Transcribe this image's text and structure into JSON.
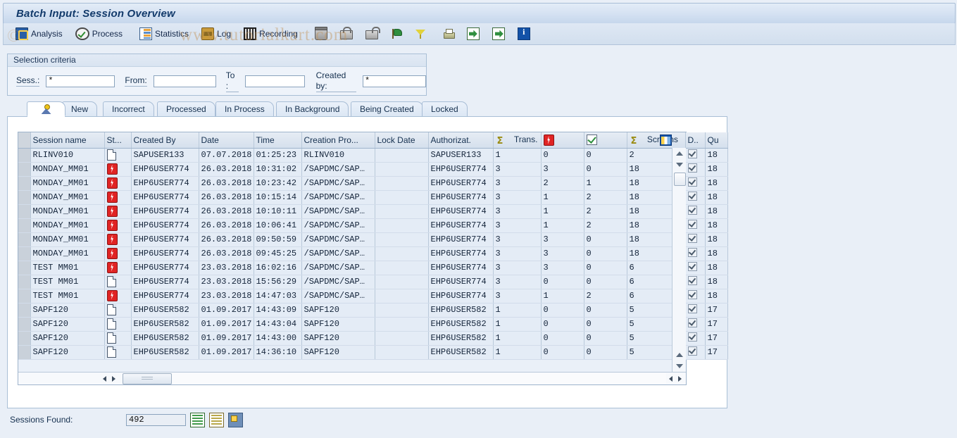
{
  "window": {
    "title": "Batch Input: Session Overview"
  },
  "watermark": {
    "text": "www.tutorialkart.com",
    "copyright": "©"
  },
  "toolbar": {
    "items": [
      {
        "label": "Analysis",
        "icon": "analysis-icon"
      },
      {
        "label": "Process",
        "icon": "process-icon"
      },
      {
        "label": "Statistics",
        "icon": "statistics-icon"
      },
      {
        "label": "Log",
        "icon": "log-icon"
      },
      {
        "label": "Recording",
        "icon": "recording-icon"
      }
    ],
    "icon_only": [
      {
        "icon": "delete-icon",
        "name": "delete-button"
      },
      {
        "icon": "lock-icon",
        "name": "lock-button"
      },
      {
        "icon": "unlock-icon",
        "name": "unlock-button"
      },
      {
        "icon": "flag-icon",
        "name": "flag-button"
      },
      {
        "icon": "filter-icon",
        "name": "filter-button"
      },
      {
        "icon": "print-icon",
        "name": "print-button"
      },
      {
        "icon": "import-icon",
        "name": "import-button"
      },
      {
        "icon": "export-icon",
        "name": "export-button"
      },
      {
        "icon": "info-icon",
        "name": "info-button"
      }
    ]
  },
  "selection": {
    "legend": "Selection criteria",
    "sess_label": "Sess.:",
    "sess_value": "*",
    "from_label": "From:",
    "from_value": "",
    "to_label": "To :",
    "to_value": "",
    "created_by_label": "Created by:",
    "created_by_value": "*"
  },
  "tabs": [
    {
      "label": "",
      "icon": "person-icon",
      "active": true
    },
    {
      "label": "New",
      "active": false
    },
    {
      "label": "Incorrect",
      "active": false
    },
    {
      "label": "Processed",
      "active": false
    },
    {
      "label": "In Process",
      "active": false
    },
    {
      "label": "In Background",
      "active": false
    },
    {
      "label": "Being Created",
      "active": false
    },
    {
      "label": "Locked",
      "active": false
    }
  ],
  "grid": {
    "columns": [
      {
        "key": "sel",
        "label": "",
        "icon": ""
      },
      {
        "key": "name",
        "label": "Session name",
        "icon": ""
      },
      {
        "key": "status",
        "label": "St...",
        "icon": ""
      },
      {
        "key": "createdby",
        "label": "Created By",
        "icon": ""
      },
      {
        "key": "date",
        "label": "Date",
        "icon": ""
      },
      {
        "key": "time",
        "label": "Time",
        "icon": ""
      },
      {
        "key": "creaprog",
        "label": "Creation Pro...",
        "icon": ""
      },
      {
        "key": "lockdate",
        "label": "Lock Date",
        "icon": ""
      },
      {
        "key": "auth",
        "label": "Authorizat.",
        "icon": ""
      },
      {
        "key": "trans",
        "label": "Trans.",
        "icon": "sigma-icon"
      },
      {
        "key": "errors",
        "label": "",
        "icon": "error-status-icon"
      },
      {
        "key": "ok",
        "label": "",
        "icon": "ok-status-icon"
      },
      {
        "key": "screens",
        "label": "Screens",
        "icon": "sigma-icon"
      },
      {
        "key": "d",
        "label": "D..",
        "icon": ""
      },
      {
        "key": "qu",
        "label": "Qu",
        "icon": ""
      }
    ],
    "config_icon": "table-settings-icon",
    "rows": [
      {
        "name": "RLINV010",
        "status": "new",
        "createdby": "SAPUSER133",
        "date": "07.07.2018",
        "time": "01:25:23",
        "creaprog": "RLINV010",
        "lockdate": "",
        "auth": "SAPUSER133",
        "trans": "1",
        "errors": "0",
        "ok": "0",
        "screens": "2",
        "d": true,
        "qu": "18"
      },
      {
        "name": "MONDAY_MM01",
        "status": "error",
        "createdby": "EHP6USER774",
        "date": "26.03.2018",
        "time": "10:31:02",
        "creaprog": "/SAPDMC/SAP…",
        "lockdate": "",
        "auth": "EHP6USER774",
        "trans": "3",
        "errors": "3",
        "ok": "0",
        "screens": "18",
        "d": true,
        "qu": "18"
      },
      {
        "name": "MONDAY_MM01",
        "status": "error",
        "createdby": "EHP6USER774",
        "date": "26.03.2018",
        "time": "10:23:42",
        "creaprog": "/SAPDMC/SAP…",
        "lockdate": "",
        "auth": "EHP6USER774",
        "trans": "3",
        "errors": "2",
        "ok": "1",
        "screens": "18",
        "d": true,
        "qu": "18"
      },
      {
        "name": "MONDAY_MM01",
        "status": "error",
        "createdby": "EHP6USER774",
        "date": "26.03.2018",
        "time": "10:15:14",
        "creaprog": "/SAPDMC/SAP…",
        "lockdate": "",
        "auth": "EHP6USER774",
        "trans": "3",
        "errors": "1",
        "ok": "2",
        "screens": "18",
        "d": true,
        "qu": "18"
      },
      {
        "name": "MONDAY_MM01",
        "status": "error",
        "createdby": "EHP6USER774",
        "date": "26.03.2018",
        "time": "10:10:11",
        "creaprog": "/SAPDMC/SAP…",
        "lockdate": "",
        "auth": "EHP6USER774",
        "trans": "3",
        "errors": "1",
        "ok": "2",
        "screens": "18",
        "d": true,
        "qu": "18"
      },
      {
        "name": "MONDAY_MM01",
        "status": "error",
        "createdby": "EHP6USER774",
        "date": "26.03.2018",
        "time": "10:06:41",
        "creaprog": "/SAPDMC/SAP…",
        "lockdate": "",
        "auth": "EHP6USER774",
        "trans": "3",
        "errors": "1",
        "ok": "2",
        "screens": "18",
        "d": true,
        "qu": "18"
      },
      {
        "name": "MONDAY_MM01",
        "status": "error",
        "createdby": "EHP6USER774",
        "date": "26.03.2018",
        "time": "09:50:59",
        "creaprog": "/SAPDMC/SAP…",
        "lockdate": "",
        "auth": "EHP6USER774",
        "trans": "3",
        "errors": "3",
        "ok": "0",
        "screens": "18",
        "d": true,
        "qu": "18"
      },
      {
        "name": "MONDAY_MM01",
        "status": "error",
        "createdby": "EHP6USER774",
        "date": "26.03.2018",
        "time": "09:45:25",
        "creaprog": "/SAPDMC/SAP…",
        "lockdate": "",
        "auth": "EHP6USER774",
        "trans": "3",
        "errors": "3",
        "ok": "0",
        "screens": "18",
        "d": true,
        "qu": "18"
      },
      {
        "name": "TEST MM01",
        "status": "error",
        "createdby": "EHP6USER774",
        "date": "23.03.2018",
        "time": "16:02:16",
        "creaprog": "/SAPDMC/SAP…",
        "lockdate": "",
        "auth": "EHP6USER774",
        "trans": "3",
        "errors": "3",
        "ok": "0",
        "screens": "6",
        "d": true,
        "qu": "18"
      },
      {
        "name": "TEST MM01",
        "status": "new",
        "createdby": "EHP6USER774",
        "date": "23.03.2018",
        "time": "15:56:29",
        "creaprog": "/SAPDMC/SAP…",
        "lockdate": "",
        "auth": "EHP6USER774",
        "trans": "3",
        "errors": "0",
        "ok": "0",
        "screens": "6",
        "d": true,
        "qu": "18"
      },
      {
        "name": "TEST MM01",
        "status": "error",
        "createdby": "EHP6USER774",
        "date": "23.03.2018",
        "time": "14:47:03",
        "creaprog": "/SAPDMC/SAP…",
        "lockdate": "",
        "auth": "EHP6USER774",
        "trans": "3",
        "errors": "1",
        "ok": "2",
        "screens": "6",
        "d": true,
        "qu": "18"
      },
      {
        "name": "SAPF120",
        "status": "new",
        "createdby": "EHP6USER582",
        "date": "01.09.2017",
        "time": "14:43:09",
        "creaprog": "SAPF120",
        "lockdate": "",
        "auth": "EHP6USER582",
        "trans": "1",
        "errors": "0",
        "ok": "0",
        "screens": "5",
        "d": true,
        "qu": "17"
      },
      {
        "name": "SAPF120",
        "status": "new",
        "createdby": "EHP6USER582",
        "date": "01.09.2017",
        "time": "14:43:04",
        "creaprog": "SAPF120",
        "lockdate": "",
        "auth": "EHP6USER582",
        "trans": "1",
        "errors": "0",
        "ok": "0",
        "screens": "5",
        "d": true,
        "qu": "17"
      },
      {
        "name": "SAPF120",
        "status": "new",
        "createdby": "EHP6USER582",
        "date": "01.09.2017",
        "time": "14:43:00",
        "creaprog": "SAPF120",
        "lockdate": "",
        "auth": "EHP6USER582",
        "trans": "1",
        "errors": "0",
        "ok": "0",
        "screens": "5",
        "d": true,
        "qu": "17"
      },
      {
        "name": "SAPF120",
        "status": "new",
        "createdby": "EHP6USER582",
        "date": "01.09.2017",
        "time": "14:36:10",
        "creaprog": "SAPF120",
        "lockdate": "",
        "auth": "EHP6USER582",
        "trans": "1",
        "errors": "0",
        "ok": "0",
        "screens": "5",
        "d": true,
        "qu": "17"
      }
    ]
  },
  "footer": {
    "sessions_found_label": "Sessions Found:",
    "sessions_found_value": "492",
    "buttons": [
      {
        "icon": "list-green-icon",
        "name": "select-all-button"
      },
      {
        "icon": "list-yellow-icon",
        "name": "deselect-all-button"
      },
      {
        "icon": "layout-icon",
        "name": "layout-button"
      }
    ]
  },
  "colors": {
    "title_text": "#123a6b",
    "window_bg": "#e9eff7",
    "grid_row_bg": "#e4ecf6",
    "error_red": "#e02424",
    "ok_green": "#2f8f3f",
    "accent_blue": "#1352a8"
  }
}
